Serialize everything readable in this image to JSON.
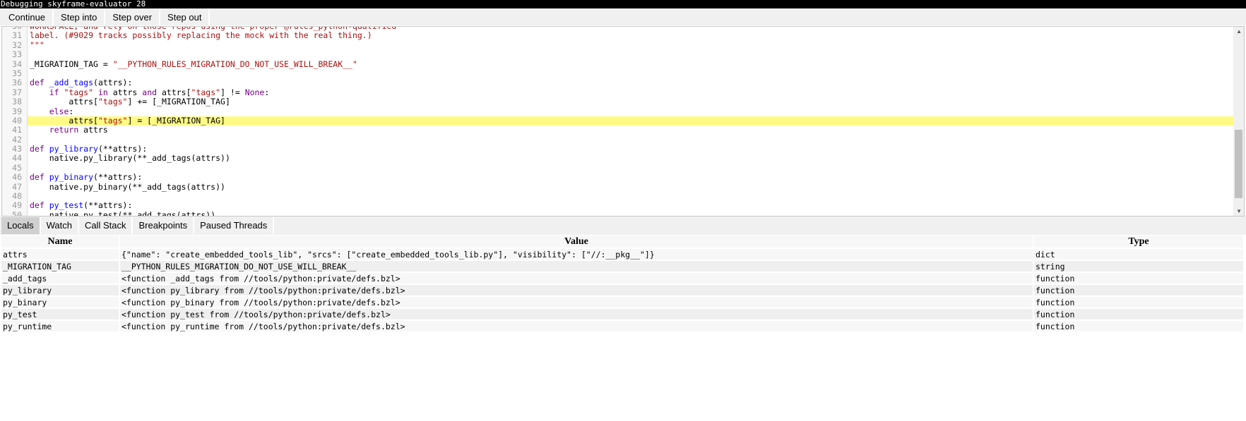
{
  "window": {
    "title": "Debugging skyframe-evaluator 28"
  },
  "toolbar": {
    "buttons": [
      "Continue",
      "Step into",
      "Step over",
      "Step out"
    ]
  },
  "editor": {
    "current_line": 40,
    "highlight_color": "#fffa86",
    "lines": [
      {
        "n": "30",
        "tokens": [
          [
            "st",
            "WORKSPACE, and rely on those repos using the proper @rules_python-qualified"
          ]
        ]
      },
      {
        "n": "31",
        "tokens": [
          [
            "st",
            "label. (#9029 tracks possibly replacing the mock with the real thing.)"
          ]
        ]
      },
      {
        "n": "32",
        "tokens": [
          [
            "st",
            "\"\"\""
          ]
        ]
      },
      {
        "n": "33",
        "tokens": []
      },
      {
        "n": "34",
        "tokens": [
          [
            "",
            "_MIGRATION_TAG = "
          ],
          [
            "st",
            "\"__PYTHON_RULES_MIGRATION_DO_NOT_USE_WILL_BREAK__\""
          ]
        ]
      },
      {
        "n": "35",
        "tokens": []
      },
      {
        "n": "36",
        "tokens": [
          [
            "kw",
            "def "
          ],
          [
            "df",
            "_add_tags"
          ],
          [
            "",
            "(attrs):"
          ]
        ]
      },
      {
        "n": "37",
        "tokens": [
          [
            "",
            "    "
          ],
          [
            "kw",
            "if "
          ],
          [
            "st",
            "\"tags\""
          ],
          [
            "kw",
            " in "
          ],
          [
            "",
            "attrs "
          ],
          [
            "kw",
            "and"
          ],
          [
            "",
            " attrs["
          ],
          [
            "st",
            "\"tags\""
          ],
          [
            "",
            "] != "
          ],
          [
            "kw",
            "None"
          ],
          [
            "",
            ":"
          ]
        ]
      },
      {
        "n": "38",
        "tokens": [
          [
            "",
            "        attrs["
          ],
          [
            "st",
            "\"tags\""
          ],
          [
            "",
            "] += [_MIGRATION_TAG]"
          ]
        ]
      },
      {
        "n": "39",
        "tokens": [
          [
            "",
            "    "
          ],
          [
            "kw",
            "else"
          ],
          [
            "",
            ":"
          ]
        ]
      },
      {
        "n": "40",
        "tokens": [
          [
            "",
            "        attrs["
          ],
          [
            "st",
            "\"tags\""
          ],
          [
            "",
            "] = [_MIGRATION_TAG]"
          ]
        ]
      },
      {
        "n": "41",
        "tokens": [
          [
            "",
            "    "
          ],
          [
            "kw",
            "return"
          ],
          [
            "",
            " attrs"
          ]
        ]
      },
      {
        "n": "42",
        "tokens": []
      },
      {
        "n": "43",
        "tokens": [
          [
            "kw",
            "def "
          ],
          [
            "df",
            "py_library"
          ],
          [
            "",
            "(**attrs):"
          ]
        ]
      },
      {
        "n": "44",
        "tokens": [
          [
            "",
            "    native.py_library(**_add_tags(attrs))"
          ]
        ]
      },
      {
        "n": "45",
        "tokens": []
      },
      {
        "n": "46",
        "tokens": [
          [
            "kw",
            "def "
          ],
          [
            "df",
            "py_binary"
          ],
          [
            "",
            "(**attrs):"
          ]
        ]
      },
      {
        "n": "47",
        "tokens": [
          [
            "",
            "    native.py_binary(**_add_tags(attrs))"
          ]
        ]
      },
      {
        "n": "48",
        "tokens": []
      },
      {
        "n": "49",
        "tokens": [
          [
            "kw",
            "def "
          ],
          [
            "df",
            "py_test"
          ],
          [
            "",
            "(**attrs):"
          ]
        ]
      },
      {
        "n": "50",
        "tokens": [
          [
            "",
            "    native.py_test(**_add_tags(attrs))"
          ]
        ]
      }
    ]
  },
  "panel": {
    "tabs": [
      "Locals",
      "Watch",
      "Call Stack",
      "Breakpoints",
      "Paused Threads"
    ],
    "active_tab": "Locals",
    "columns": [
      "Name",
      "Value",
      "Type"
    ],
    "rows": [
      [
        "attrs",
        "{\"name\": \"create_embedded_tools_lib\", \"srcs\": [\"create_embedded_tools_lib.py\"], \"visibility\": [\"//:__pkg__\"]}",
        "dict"
      ],
      [
        "_MIGRATION_TAG",
        "__PYTHON_RULES_MIGRATION_DO_NOT_USE_WILL_BREAK__",
        "string"
      ],
      [
        "_add_tags",
        "<function _add_tags from //tools/python:private/defs.bzl>",
        "function"
      ],
      [
        "py_library",
        "<function py_library from //tools/python:private/defs.bzl>",
        "function"
      ],
      [
        "py_binary",
        "<function py_binary from //tools/python:private/defs.bzl>",
        "function"
      ],
      [
        "py_test",
        "<function py_test from //tools/python:private/defs.bzl>",
        "function"
      ],
      [
        "py_runtime",
        "<function py_runtime from //tools/python:private/defs.bzl>",
        "function"
      ]
    ]
  }
}
